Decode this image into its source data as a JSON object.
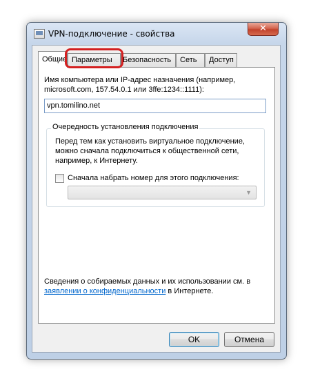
{
  "window": {
    "title": "VPN-подключение - свойства",
    "close_glyph": "✕"
  },
  "tabs": [
    {
      "label": "Общие"
    },
    {
      "label": "Параметры"
    },
    {
      "label": "Безопасность"
    },
    {
      "label": "Сеть"
    },
    {
      "label": "Доступ"
    }
  ],
  "general": {
    "host_label_line1": "Имя компьютера или IP-адрес назначения (например,",
    "host_label_line2": "microsoft.com, 157.54.0.1 или 3ffe:1234::1111):",
    "host_value": "vpn.tomilino.net",
    "group_title": "Очередность установления подключения",
    "group_text_line1": "Перед тем как установить виртуальное подключение,",
    "group_text_line2": "можно сначала подключиться к общественной сети,",
    "group_text_line3": "например, к Интернету.",
    "dial_first_label": "Сначала набрать номер для этого подключения:",
    "dial_first_checked": false,
    "privacy_text_line1": "Сведения о собираемых данных и их использовании см. в",
    "privacy_link": "заявлении о конфиденциальности",
    "privacy_text_suffix": " в Интернете."
  },
  "buttons": {
    "ok": "OK",
    "cancel": "Отмена"
  },
  "colors": {
    "highlight": "#d42020",
    "link": "#0066cc"
  }
}
